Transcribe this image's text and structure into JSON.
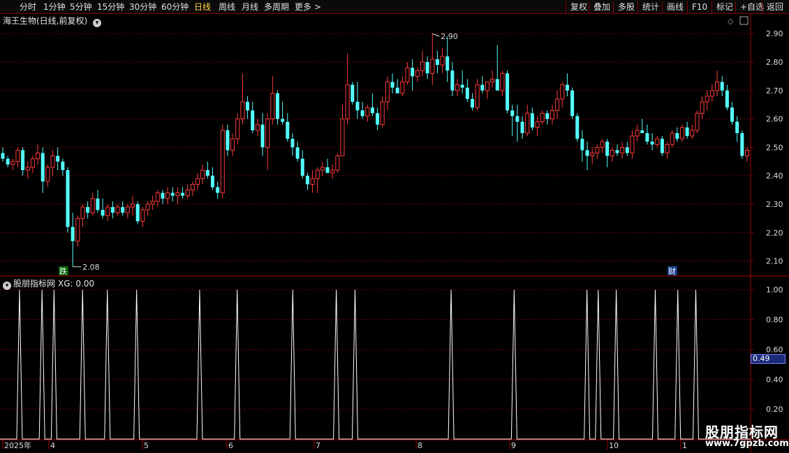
{
  "toolbar": {
    "periods": [
      "分时",
      "1分钟",
      "5分钟",
      "15分钟",
      "30分钟",
      "60分钟",
      "日线",
      "周线",
      "月线",
      "多周期",
      "更多 >"
    ],
    "active": "日线",
    "tools": [
      "复权",
      "叠加",
      "多股",
      "统计",
      "画线",
      "F10",
      "标记",
      "+自选",
      "返回"
    ]
  },
  "main": {
    "title": "海王生物(日线,前复权)",
    "high_label": "2.90",
    "low_label": "2.08",
    "badge_drop": "跌",
    "badge_fin": "财",
    "y_ticks": [
      "2.90",
      "2.80",
      "2.70",
      "2.60",
      "2.50",
      "2.40",
      "2.30",
      "2.20",
      "2.10"
    ]
  },
  "indicator": {
    "title": "股朋指标网",
    "xg_label": "XG: 0.00",
    "y_ticks": [
      "1.00",
      "0.80",
      "0.60",
      "0.40",
      "0.20"
    ],
    "current_value": "0.49"
  },
  "x_axis": {
    "labels": [
      "2025年",
      "4",
      "5",
      "6",
      "7",
      "8",
      "9",
      "10",
      "1"
    ]
  },
  "watermark": {
    "cn": "股朋指标网",
    "url": "www.7gpzb.com"
  },
  "colors": {
    "up": "#ff3b3b",
    "down": "#54ffff",
    "grid": "#7a0000",
    "line": "#ffffff"
  },
  "chart_data": {
    "type": "candlestick",
    "ylim": [
      2.05,
      2.93
    ],
    "high": 2.9,
    "low": 2.08,
    "candles": [
      [
        2.48,
        2.5,
        2.45,
        2.46
      ],
      [
        2.46,
        2.47,
        2.43,
        2.44
      ],
      [
        2.44,
        2.46,
        2.42,
        2.45
      ],
      [
        2.45,
        2.5,
        2.43,
        2.49
      ],
      [
        2.49,
        2.5,
        2.4,
        2.42
      ],
      [
        2.42,
        2.45,
        2.39,
        2.43
      ],
      [
        2.43,
        2.47,
        2.41,
        2.46
      ],
      [
        2.46,
        2.51,
        2.44,
        2.48
      ],
      [
        2.48,
        2.5,
        2.34,
        2.38
      ],
      [
        2.38,
        2.44,
        2.36,
        2.43
      ],
      [
        2.43,
        2.49,
        2.4,
        2.47
      ],
      [
        2.47,
        2.5,
        2.42,
        2.45
      ],
      [
        2.45,
        2.46,
        2.4,
        2.42
      ],
      [
        2.42,
        2.43,
        2.2,
        2.22
      ],
      [
        2.22,
        2.27,
        2.08,
        2.17
      ],
      [
        2.17,
        2.26,
        2.15,
        2.25
      ],
      [
        2.25,
        2.3,
        2.22,
        2.29
      ],
      [
        2.29,
        2.31,
        2.25,
        2.27
      ],
      [
        2.27,
        2.34,
        2.26,
        2.32
      ],
      [
        2.32,
        2.35,
        2.27,
        2.28
      ],
      [
        2.28,
        2.32,
        2.25,
        2.26
      ],
      [
        2.26,
        2.3,
        2.24,
        2.29
      ],
      [
        2.29,
        2.31,
        2.25,
        2.27
      ],
      [
        2.27,
        2.3,
        2.26,
        2.29
      ],
      [
        2.29,
        2.31,
        2.26,
        2.27
      ],
      [
        2.27,
        2.3,
        2.25,
        2.29
      ],
      [
        2.29,
        2.33,
        2.26,
        2.3
      ],
      [
        2.3,
        2.31,
        2.23,
        2.24
      ],
      [
        2.24,
        2.29,
        2.22,
        2.28
      ],
      [
        2.28,
        2.31,
        2.26,
        2.3
      ],
      [
        2.3,
        2.33,
        2.28,
        2.31
      ],
      [
        2.31,
        2.35,
        2.29,
        2.34
      ],
      [
        2.34,
        2.35,
        2.3,
        2.32
      ],
      [
        2.32,
        2.36,
        2.3,
        2.34
      ],
      [
        2.34,
        2.36,
        2.31,
        2.33
      ],
      [
        2.33,
        2.36,
        2.3,
        2.34
      ],
      [
        2.34,
        2.36,
        2.32,
        2.33
      ],
      [
        2.33,
        2.37,
        2.32,
        2.35
      ],
      [
        2.35,
        2.38,
        2.33,
        2.37
      ],
      [
        2.37,
        2.41,
        2.35,
        2.39
      ],
      [
        2.39,
        2.44,
        2.37,
        2.42
      ],
      [
        2.42,
        2.45,
        2.39,
        2.4
      ],
      [
        2.4,
        2.43,
        2.35,
        2.36
      ],
      [
        2.36,
        2.38,
        2.32,
        2.34
      ],
      [
        2.34,
        2.58,
        2.32,
        2.56
      ],
      [
        2.56,
        2.58,
        2.47,
        2.49
      ],
      [
        2.49,
        2.55,
        2.47,
        2.53
      ],
      [
        2.53,
        2.62,
        2.51,
        2.6
      ],
      [
        2.6,
        2.76,
        2.58,
        2.66
      ],
      [
        2.66,
        2.68,
        2.6,
        2.63
      ],
      [
        2.63,
        2.66,
        2.55,
        2.56
      ],
      [
        2.56,
        2.6,
        2.54,
        2.58
      ],
      [
        2.58,
        2.62,
        2.47,
        2.5
      ],
      [
        2.5,
        2.62,
        2.42,
        2.6
      ],
      [
        2.6,
        2.75,
        2.58,
        2.69
      ],
      [
        2.69,
        2.7,
        2.58,
        2.6
      ],
      [
        2.6,
        2.66,
        2.58,
        2.59
      ],
      [
        2.59,
        2.62,
        2.52,
        2.53
      ],
      [
        2.53,
        2.55,
        2.47,
        2.5
      ],
      [
        2.5,
        2.52,
        2.45,
        2.46
      ],
      [
        2.46,
        2.49,
        2.39,
        2.4
      ],
      [
        2.4,
        2.41,
        2.35,
        2.37
      ],
      [
        2.37,
        2.42,
        2.34,
        2.39
      ],
      [
        2.39,
        2.43,
        2.34,
        2.42
      ],
      [
        2.42,
        2.45,
        2.4,
        2.43
      ],
      [
        2.43,
        2.46,
        2.41,
        2.41
      ],
      [
        2.41,
        2.44,
        2.39,
        2.42
      ],
      [
        2.42,
        2.48,
        2.41,
        2.47
      ],
      [
        2.47,
        2.65,
        2.58,
        2.6
      ],
      [
        2.6,
        2.83,
        2.58,
        2.72
      ],
      [
        2.72,
        2.73,
        2.65,
        2.66
      ],
      [
        2.66,
        2.73,
        2.6,
        2.63
      ],
      [
        2.63,
        2.66,
        2.6,
        2.61
      ],
      [
        2.61,
        2.65,
        2.59,
        2.64
      ],
      [
        2.64,
        2.69,
        2.61,
        2.62
      ],
      [
        2.62,
        2.64,
        2.56,
        2.58
      ],
      [
        2.58,
        2.68,
        2.57,
        2.66
      ],
      [
        2.66,
        2.75,
        2.63,
        2.73
      ],
      [
        2.73,
        2.76,
        2.69,
        2.71
      ],
      [
        2.71,
        2.74,
        2.69,
        2.69
      ],
      [
        2.69,
        2.75,
        2.68,
        2.73
      ],
      [
        2.73,
        2.8,
        2.72,
        2.78
      ],
      [
        2.78,
        2.81,
        2.7,
        2.75
      ],
      [
        2.75,
        2.78,
        2.73,
        2.77
      ],
      [
        2.77,
        2.84,
        2.75,
        2.8
      ],
      [
        2.8,
        2.82,
        2.74,
        2.76
      ],
      [
        2.76,
        2.9,
        2.72,
        2.81
      ],
      [
        2.81,
        2.84,
        2.76,
        2.79
      ],
      [
        2.79,
        2.85,
        2.76,
        2.82
      ],
      [
        2.82,
        2.89,
        2.73,
        2.77
      ],
      [
        2.77,
        2.8,
        2.68,
        2.7
      ],
      [
        2.7,
        2.74,
        2.68,
        2.72
      ],
      [
        2.72,
        2.77,
        2.69,
        2.71
      ],
      [
        2.71,
        2.74,
        2.66,
        2.67
      ],
      [
        2.67,
        2.69,
        2.63,
        2.64
      ],
      [
        2.64,
        2.74,
        2.63,
        2.72
      ],
      [
        2.72,
        2.75,
        2.69,
        2.7
      ],
      [
        2.7,
        2.73,
        2.67,
        2.73
      ],
      [
        2.73,
        2.77,
        2.71,
        2.74
      ],
      [
        2.74,
        2.86,
        2.7,
        2.7
      ],
      [
        2.7,
        2.77,
        2.68,
        2.76
      ],
      [
        2.76,
        2.77,
        2.62,
        2.63
      ],
      [
        2.63,
        2.65,
        2.54,
        2.61
      ],
      [
        2.61,
        2.65,
        2.52,
        2.59
      ],
      [
        2.59,
        2.61,
        2.53,
        2.55
      ],
      [
        2.55,
        2.65,
        2.54,
        2.62
      ],
      [
        2.62,
        2.64,
        2.56,
        2.57
      ],
      [
        2.57,
        2.61,
        2.54,
        2.59
      ],
      [
        2.59,
        2.63,
        2.58,
        2.62
      ],
      [
        2.62,
        2.63,
        2.58,
        2.6
      ],
      [
        2.6,
        2.65,
        2.58,
        2.63
      ],
      [
        2.63,
        2.7,
        2.6,
        2.67
      ],
      [
        2.67,
        2.73,
        2.64,
        2.72
      ],
      [
        2.72,
        2.76,
        2.68,
        2.7
      ],
      [
        2.7,
        2.71,
        2.6,
        2.61
      ],
      [
        2.61,
        2.62,
        2.52,
        2.53
      ],
      [
        2.53,
        2.56,
        2.45,
        2.49
      ],
      [
        2.49,
        2.52,
        2.42,
        2.47
      ],
      [
        2.47,
        2.5,
        2.44,
        2.48
      ],
      [
        2.48,
        2.51,
        2.46,
        2.5
      ],
      [
        2.5,
        2.53,
        2.48,
        2.52
      ],
      [
        2.52,
        2.53,
        2.43,
        2.47
      ],
      [
        2.47,
        2.5,
        2.45,
        2.49
      ],
      [
        2.49,
        2.51,
        2.47,
        2.48
      ],
      [
        2.48,
        2.52,
        2.46,
        2.5
      ],
      [
        2.5,
        2.52,
        2.47,
        2.48
      ],
      [
        2.48,
        2.56,
        2.46,
        2.54
      ],
      [
        2.54,
        2.58,
        2.52,
        2.56
      ],
      [
        2.56,
        2.6,
        2.55,
        2.55
      ],
      [
        2.55,
        2.58,
        2.51,
        2.52
      ],
      [
        2.52,
        2.55,
        2.49,
        2.51
      ],
      [
        2.51,
        2.54,
        2.5,
        2.53
      ],
      [
        2.53,
        2.54,
        2.47,
        2.48
      ],
      [
        2.48,
        2.52,
        2.46,
        2.51
      ],
      [
        2.51,
        2.56,
        2.5,
        2.55
      ],
      [
        2.55,
        2.57,
        2.52,
        2.53
      ],
      [
        2.53,
        2.58,
        2.52,
        2.57
      ],
      [
        2.57,
        2.59,
        2.53,
        2.54
      ],
      [
        2.54,
        2.58,
        2.53,
        2.56
      ],
      [
        2.56,
        2.63,
        2.55,
        2.62
      ],
      [
        2.62,
        2.68,
        2.6,
        2.66
      ],
      [
        2.66,
        2.7,
        2.63,
        2.68
      ],
      [
        2.68,
        2.72,
        2.66,
        2.7
      ],
      [
        2.7,
        2.77,
        2.68,
        2.73
      ],
      [
        2.73,
        2.75,
        2.68,
        2.7
      ],
      [
        2.7,
        2.72,
        2.63,
        2.64
      ],
      [
        2.64,
        2.66,
        2.58,
        2.59
      ],
      [
        2.59,
        2.61,
        2.52,
        2.55
      ],
      [
        2.55,
        2.56,
        2.46,
        2.47
      ],
      [
        2.47,
        2.5,
        2.45,
        2.49
      ]
    ],
    "indicator": {
      "name": "XG",
      "ylim": [
        0,
        1.05
      ],
      "spike_positions": [
        0.026,
        0.056,
        0.072,
        0.11,
        0.143,
        0.182,
        0.266,
        0.316,
        0.39,
        0.448,
        0.473,
        0.601,
        0.685,
        0.782,
        0.797,
        0.821,
        0.873,
        0.903,
        0.927
      ]
    }
  }
}
